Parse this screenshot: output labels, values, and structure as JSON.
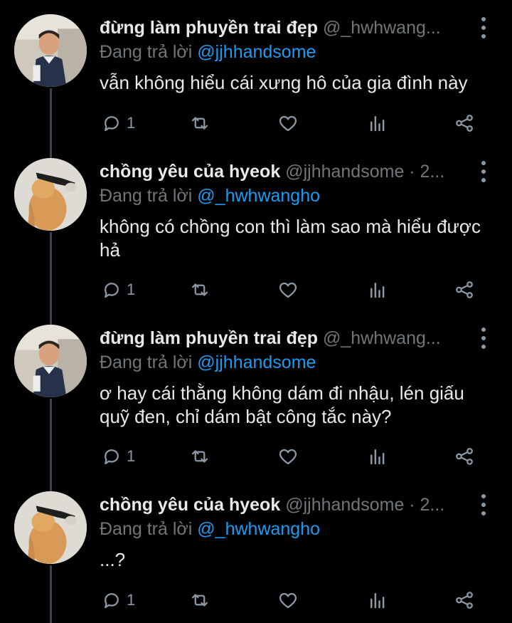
{
  "tweets": [
    {
      "name": "đừng làm phuyền trai đẹp",
      "handle": "@_hwhwang...",
      "reply_label": "Đang trả lời",
      "reply_to": "@jjhhandsome",
      "text": "vẫn không hiểu cái xưng hô của gia đình này",
      "reply_count": "1",
      "avatar": "avatar-child-photo"
    },
    {
      "name": "chồng yêu của hyeok",
      "handle": "@jjhhandsome · 2...",
      "reply_label": "Đang trả lời",
      "reply_to": "@_hwhwangho",
      "text": "không có chồng con thì làm sao mà hiểu được hả",
      "reply_count": "1",
      "avatar": "avatar-cat-photo"
    },
    {
      "name": "đừng làm phuyền trai đẹp",
      "handle": "@_hwhwang...",
      "reply_label": "Đang trả lời",
      "reply_to": "@jjhhandsome",
      "text": "ơ hay cái thằng không dám đi nhậu, lén giấu quỹ đen, chỉ dám bật công tắc này?",
      "reply_count": "1",
      "avatar": "avatar-child-photo"
    },
    {
      "name": "chồng yêu của hyeok",
      "handle": "@jjhhandsome · 2...",
      "reply_label": "Đang trả lời",
      "reply_to": "@_hwhwangho",
      "text": "...?",
      "reply_count": "1",
      "avatar": "avatar-cat-photo"
    }
  ],
  "icons": {
    "reply": "reply-icon",
    "retweet": "retweet-icon",
    "like": "like-icon",
    "views": "views-icon",
    "share": "share-icon",
    "more": "more-icon"
  },
  "colors": {
    "background": "#000000",
    "text": "#e7e9ea",
    "secondary": "#71767b",
    "mention": "#1d9bf0",
    "thread_line": "#3d4044"
  }
}
